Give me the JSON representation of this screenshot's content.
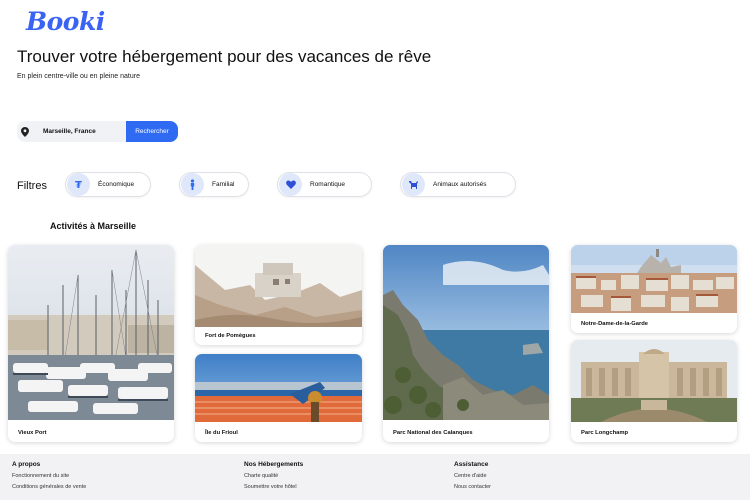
{
  "brand": {
    "logo": "Booki",
    "accent": "#3a63f5"
  },
  "hero": {
    "title": "Trouver votre hébergement pour des vacances de rêve",
    "subtitle": "En plein centre-ville ou en pleine nature"
  },
  "search": {
    "value": "Marseille, France",
    "button_label": "Rechercher",
    "icon": "location-pin-icon"
  },
  "filters": {
    "label": "Filtres",
    "chips": [
      {
        "label": "Économique",
        "icon": "money-icon"
      },
      {
        "label": "Familial",
        "icon": "family-icon"
      },
      {
        "label": "Romantique",
        "icon": "heart-icon"
      },
      {
        "label": "Animaux autorisés",
        "icon": "dog-icon"
      }
    ]
  },
  "activities": {
    "title": "Activités à Marseille",
    "cards": [
      {
        "caption": "Vieux Port"
      },
      {
        "caption": "Fort de Pomègues"
      },
      {
        "caption": "Île du Frioul"
      },
      {
        "caption": "Parc National des Calanques"
      },
      {
        "caption": "Notre-Dame-de-la-Garde"
      },
      {
        "caption": "Parc Longchamp"
      }
    ]
  },
  "footer": {
    "col1": {
      "heading": "A propos",
      "links": [
        "Fonctionnement du site",
        "Conditions générales de vente"
      ]
    },
    "col2": {
      "heading": "Nos Hébergements",
      "links": [
        "Charte qualité",
        "Soumettre votre hôtel"
      ]
    },
    "col3": {
      "heading": "Assistance",
      "links": [
        "Centre d'aide",
        "Nous contacter"
      ]
    }
  }
}
